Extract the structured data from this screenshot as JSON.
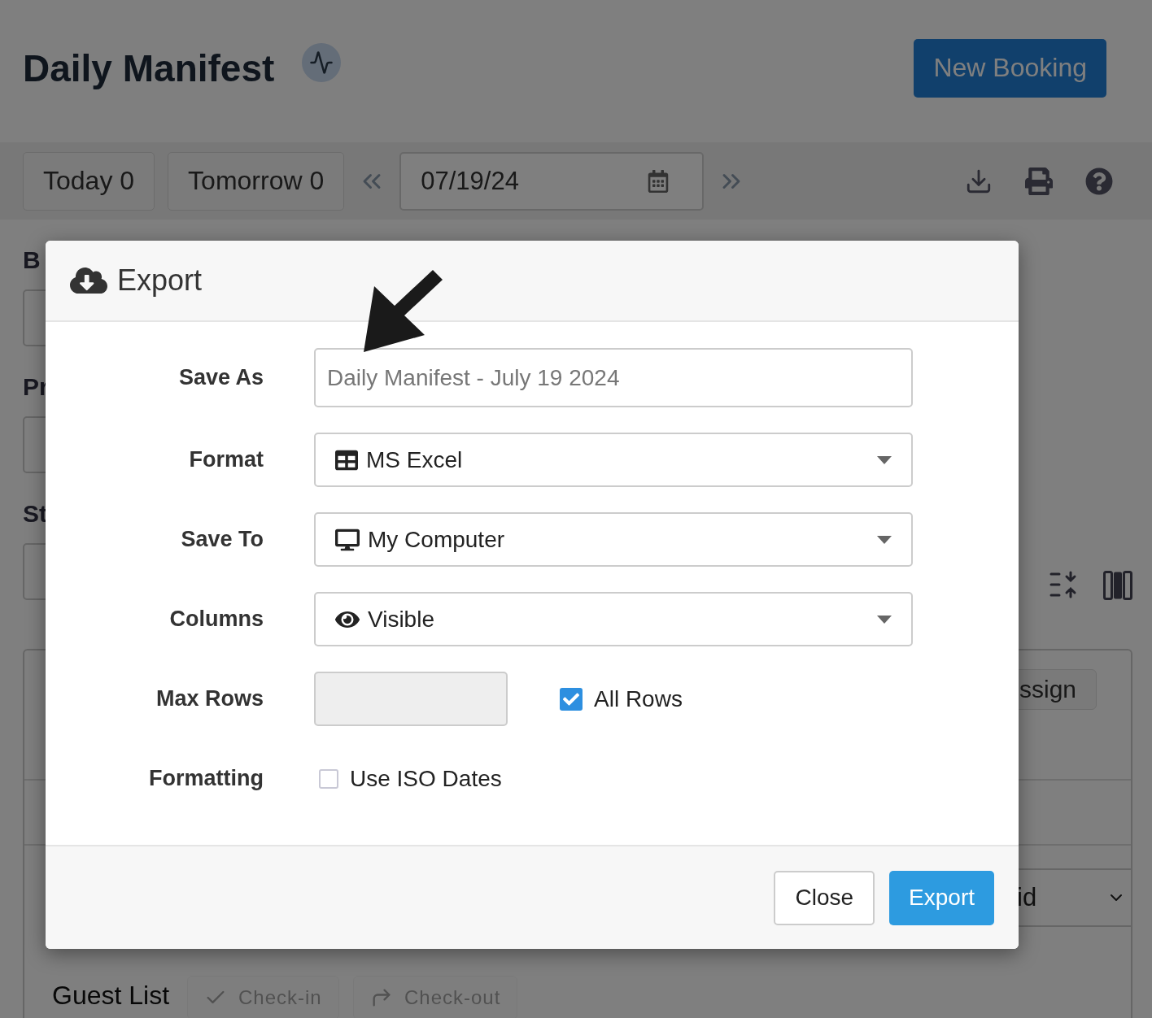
{
  "header": {
    "title": "Daily Manifest",
    "new_booking": "New Booking"
  },
  "toolbar": {
    "quick_dates": [
      {
        "label": "Today 0"
      },
      {
        "label": "Tomorrow 0"
      }
    ],
    "date": "07/19/24"
  },
  "filters": [
    {
      "label": "B"
    },
    {
      "label": "Pr"
    },
    {
      "label": "St"
    }
  ],
  "card": {
    "assign_button": "ssign",
    "select_value": "id",
    "title": "Guest List",
    "actions": [
      {
        "label": "Check-in",
        "disabled": true
      },
      {
        "label": "Check-out",
        "disabled": true
      }
    ]
  },
  "dialog": {
    "title": "Export",
    "fields": [
      {
        "label": "Save As",
        "kind": "text",
        "placeholder": "Daily Manifest - July 19 2024"
      },
      {
        "label": "Format",
        "kind": "select",
        "value": "MS Excel"
      },
      {
        "label": "Save To",
        "kind": "select",
        "value": "My Computer"
      },
      {
        "label": "Columns",
        "kind": "select",
        "value": "Visible"
      },
      {
        "label": "Max Rows",
        "kind": "limit",
        "disabled": true,
        "option": {
          "label": "All Rows",
          "checked": true
        }
      },
      {
        "label": "Formatting",
        "kind": "checkbox",
        "option": {
          "label": "Use ISO Dates",
          "checked": false
        }
      }
    ],
    "buttons": [
      {
        "label": "Close",
        "primary": false
      },
      {
        "label": "Export",
        "primary": true
      }
    ]
  }
}
